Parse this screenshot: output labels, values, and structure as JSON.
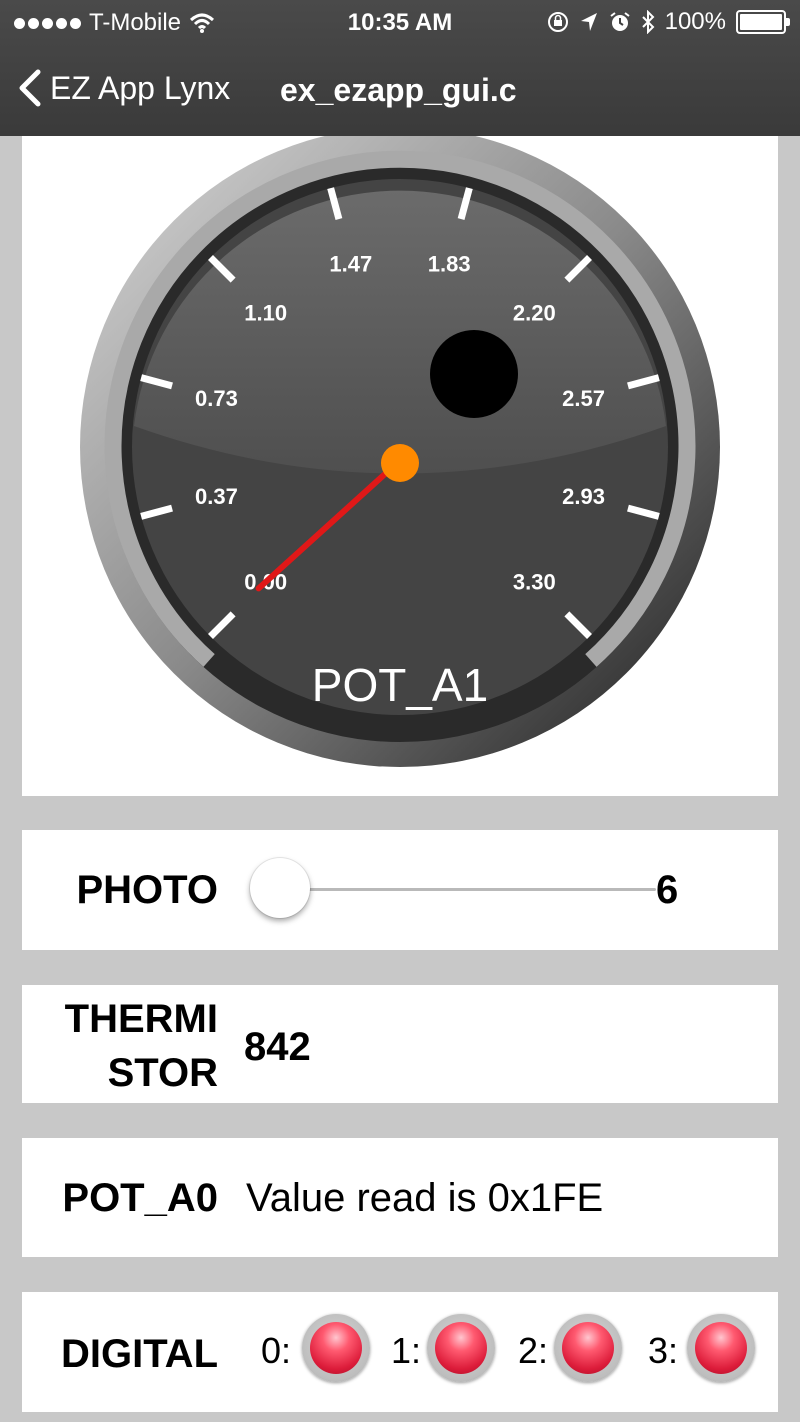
{
  "status_bar": {
    "carrier": "T-Mobile",
    "time": "10:35 AM",
    "battery": "100%"
  },
  "nav": {
    "back_label": "EZ App Lynx",
    "title": "ex_ezapp_gui.c"
  },
  "gauge": {
    "label": "POT_A1",
    "min": 0.0,
    "max": 3.3,
    "value": 0.0,
    "tick_labels": [
      "0.00",
      "0.37",
      "0.73",
      "1.10",
      "1.47",
      "1.83",
      "2.20",
      "2.57",
      "2.93",
      "3.30"
    ]
  },
  "photo": {
    "label": "PHOTO",
    "value": "6",
    "level": 0.0
  },
  "thermistor": {
    "label_line1": "THERMI",
    "label_line2": "STOR",
    "value": "842"
  },
  "pot_a0": {
    "label": "POT_A0",
    "value": "Value read is 0x1FE"
  },
  "digital": {
    "label": "DIGITAL",
    "leds": [
      {
        "label": "0:",
        "state": "on"
      },
      {
        "label": "1:",
        "state": "on"
      },
      {
        "label": "2:",
        "state": "on"
      },
      {
        "label": "3:",
        "state": "on"
      }
    ]
  },
  "colors": {
    "led_on": "#e0203c",
    "needle": "#e02020",
    "pivot": "#ff8a00",
    "header": "#3f3f3f"
  }
}
